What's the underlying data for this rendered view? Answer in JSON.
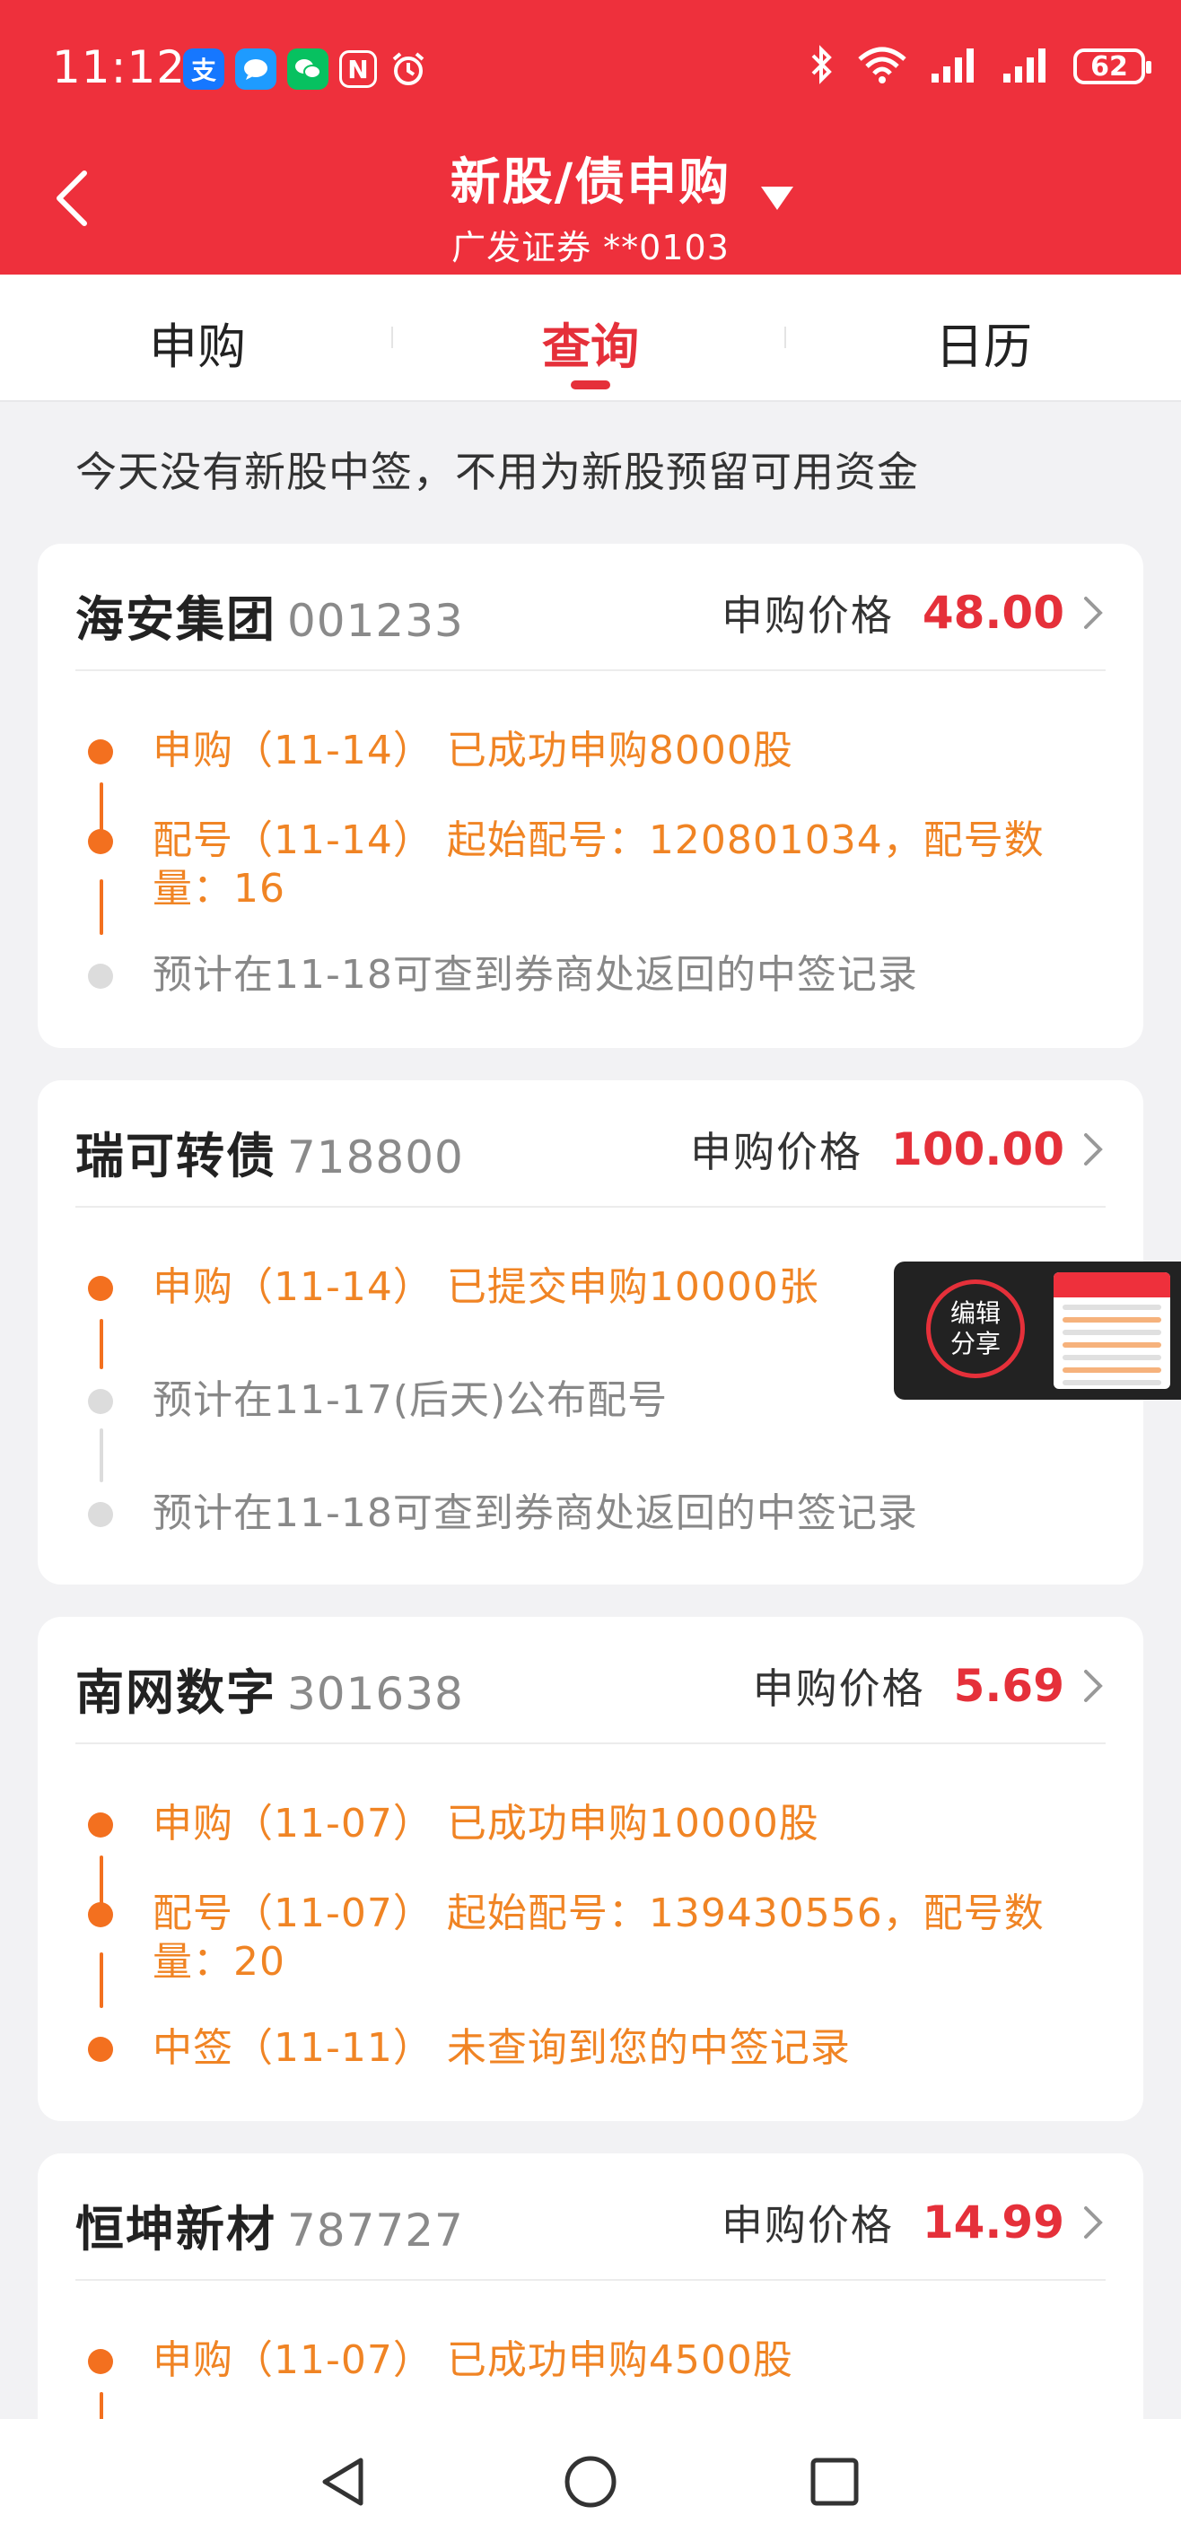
{
  "status_bar": {
    "time": "11:12",
    "battery": "62",
    "notification_icons": [
      {
        "name": "alipay-icon",
        "glyph": "支",
        "color": "#1677ff"
      },
      {
        "name": "message-icon",
        "glyph": "",
        "color": "#1e9bff"
      },
      {
        "name": "wechat-icon",
        "glyph": "",
        "color": "#07c160"
      },
      {
        "name": "nfc-icon",
        "glyph": "N",
        "color": "transparent"
      },
      {
        "name": "alarm-icon",
        "glyph": "",
        "color": "transparent"
      }
    ]
  },
  "header": {
    "title": "新股/债申购",
    "subtitle": "广发证券 **0103",
    "background": "#ee303c"
  },
  "tabs": [
    {
      "label": "申购",
      "active": false
    },
    {
      "label": "查询",
      "active": true
    },
    {
      "label": "日历",
      "active": false
    }
  ],
  "notice": "今天没有新股中签，不用为新股预留可用资金",
  "cards": [
    {
      "name": "海安集团",
      "code": "001233",
      "price_label": "申购价格",
      "price": "48.00",
      "events": [
        {
          "text": "申购（11-14） 已成功申购8000股",
          "status": "orange"
        },
        {
          "text": "配号（11-14） 起始配号：120801034，配号数量：16",
          "status": "orange"
        },
        {
          "text": "预计在11-18可查到券商处返回的中签记录",
          "status": "gray"
        }
      ]
    },
    {
      "name": "瑞可转债",
      "code": "718800",
      "price_label": "申购价格",
      "price": "100.00",
      "events": [
        {
          "text": "申购（11-14） 已提交申购10000张",
          "status": "orange"
        },
        {
          "text": "预计在11-17(后天)公布配号",
          "status": "gray"
        },
        {
          "text": "预计在11-18可查到券商处返回的中签记录",
          "status": "gray"
        }
      ]
    },
    {
      "name": "南网数字",
      "code": "301638",
      "price_label": "申购价格",
      "price": "5.69",
      "events": [
        {
          "text": "申购（11-07） 已成功申购10000股",
          "status": "orange"
        },
        {
          "text": "配号（11-07） 起始配号：139430556，配号数量：20",
          "status": "orange"
        },
        {
          "text": "中签（11-11） 未查询到您的中签记录",
          "status": "orange"
        }
      ]
    },
    {
      "name": "恒坤新材",
      "code": "787727",
      "price_label": "申购价格",
      "price": "14.99",
      "events": [
        {
          "text": "申购（11-07） 已成功申购4500股",
          "status": "orange"
        }
      ]
    }
  ],
  "floating_panel": {
    "line1": "编辑",
    "line2": "分享"
  },
  "colors": {
    "accent_red": "#e5303a",
    "timeline_orange": "#f08424",
    "timeline_gray": "#888888"
  }
}
